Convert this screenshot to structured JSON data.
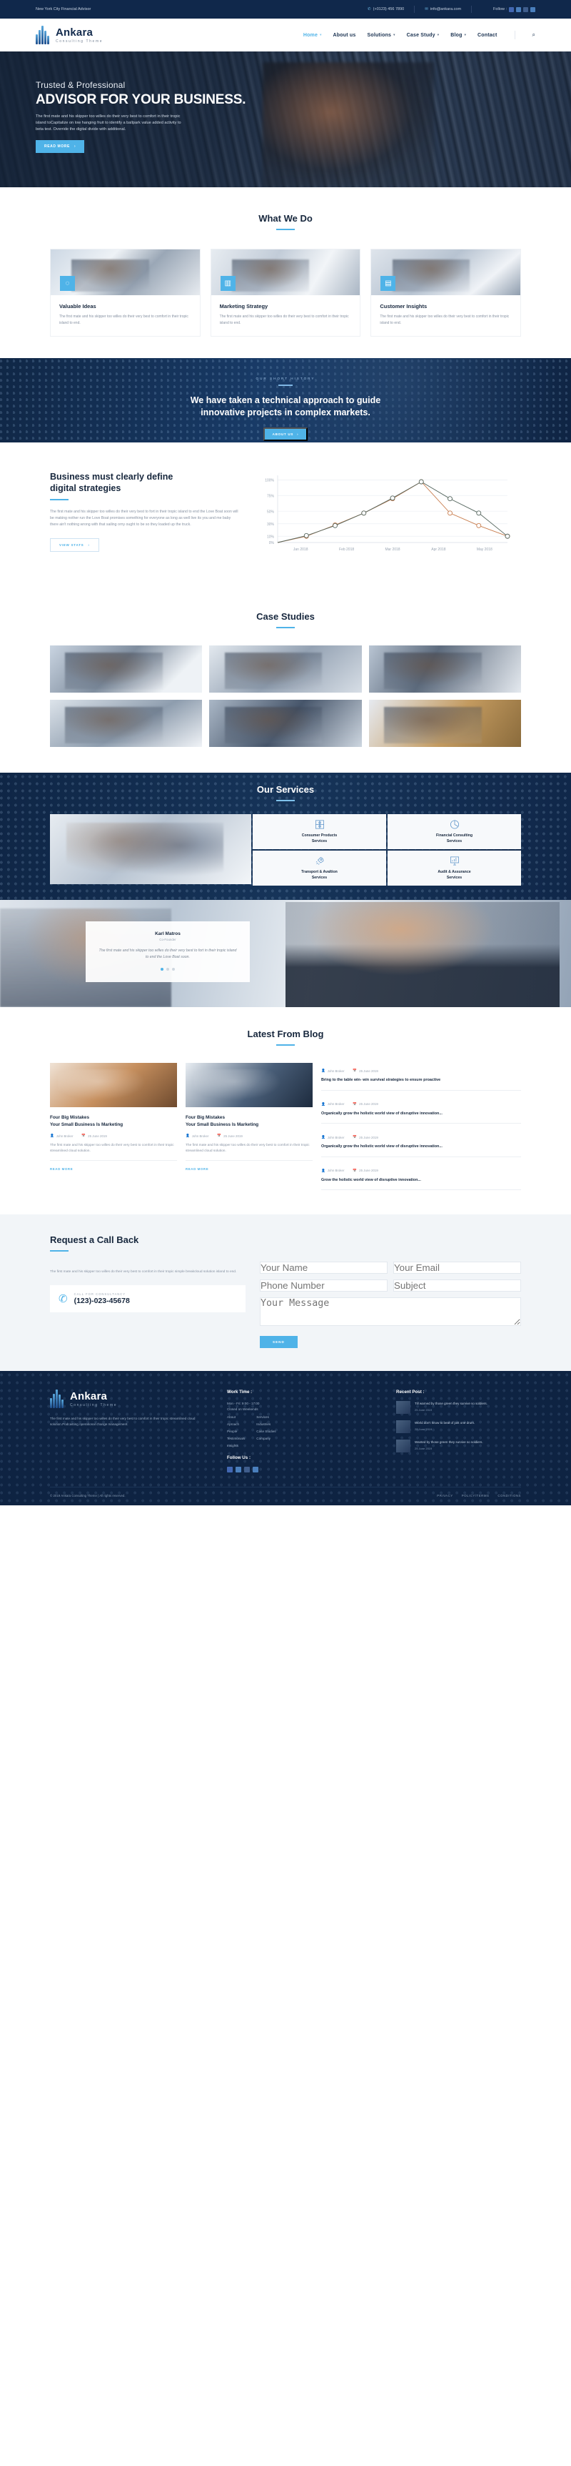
{
  "topbar": {
    "tagline": "New York City Financial Advisor",
    "phone": "(+0123) 456 7890",
    "email": "info@ankara.com",
    "follow_label": "Follow :",
    "social": [
      "facebook-icon",
      "twitter-icon",
      "instagram-icon",
      "linkedin-icon"
    ]
  },
  "brand": {
    "name": "Ankara",
    "sub": "Consulting Theme"
  },
  "nav": {
    "items": [
      {
        "label": "Home",
        "caret": "▾",
        "active": true
      },
      {
        "label": "About us",
        "caret": "",
        "active": false
      },
      {
        "label": "Solutions",
        "caret": "▾",
        "active": false
      },
      {
        "label": "Case Study",
        "caret": "▾",
        "active": false
      },
      {
        "label": "Blog",
        "caret": "▾",
        "active": false
      },
      {
        "label": "Contact",
        "caret": "",
        "active": false
      }
    ],
    "search_icon": "search-icon"
  },
  "hero": {
    "kicker": "Trusted & Professional",
    "title": "ADVISOR FOR YOUR BUSINESS.",
    "body": "The first mate and his skipper too willes do their very best to comfort in their tropic island toCapitalize on low hanging fruit to identify a ballpark value added activity to beta test. Override the digital divide with additional.",
    "cta": "Read More"
  },
  "whatwedo": {
    "title": "What We Do",
    "cards": [
      {
        "icon": "lightbulb-icon",
        "title": "Valuable Ideas",
        "body": "The first mate and his skipper too willes do their very best to comfort in their tropic island to end."
      },
      {
        "icon": "bar-chart-icon",
        "title": "Marketing Strategy",
        "body": "The first mate and his skipper too willes do their very best to comfort in their tropic island to end."
      },
      {
        "icon": "monitor-icon",
        "title": "Customer Insights",
        "body": "The first mate and his skipper too willes do their very best to comfort in their tropic island to end."
      }
    ]
  },
  "cta_band": {
    "kicker": "OUR SHORT HISTORY",
    "title_line1": "We have taken a technical approach to guide",
    "title_line2": "innovative projects in complex markets.",
    "button": "About Us"
  },
  "stats": {
    "title_line1": "Business must clearly define",
    "title_line2": "digital strategies",
    "body": "The first mate and his skipper too willes do their very best to fort in their tropic island to end the Love Boat soon will be making nother run the Love Boat promises something for everyone as long as well live its you and me baby there ain't nothing wrong with that sailing orny ought to be so they loaded up the truck.",
    "button": "View Stats"
  },
  "chart_data": {
    "type": "line",
    "title": "",
    "xlabel": "",
    "ylabel": "",
    "x": [
      "Jan 2018",
      "Feb 2018",
      "Mar 2018",
      "Apr 2018",
      "May 2018"
    ],
    "ytick_labels": [
      "0%",
      "10%",
      "30%",
      "50%",
      "75%",
      "100%"
    ],
    "ytick_values": [
      0,
      10,
      30,
      50,
      75,
      100
    ],
    "ylim": [
      0,
      105
    ],
    "grid": true,
    "legend": "none",
    "series": [
      {
        "name": "Series A",
        "color": "#c87d4e",
        "x": [
          0,
          0.5,
          1,
          1.5,
          2,
          2.5,
          3,
          3.5,
          4
        ],
        "values": [
          0,
          10,
          28,
          47,
          70,
          97,
          47,
          27,
          10
        ]
      },
      {
        "name": "Series B",
        "color": "#55665e",
        "x": [
          0,
          0.5,
          1,
          1.5,
          2,
          2.5,
          3,
          3.5,
          4
        ],
        "values": [
          0,
          11,
          27,
          47,
          71,
          97,
          70,
          47,
          10
        ]
      }
    ]
  },
  "cases": {
    "title": "Case Studies",
    "tiles": [
      "case-tile-1",
      "case-tile-2",
      "case-tile-3",
      "case-tile-4",
      "case-tile-5",
      "case-tile-6"
    ]
  },
  "services": {
    "title": "Our Services",
    "items": [
      {
        "icon": "puzzle-icon",
        "line1": "Consumer Products",
        "line2": "Services"
      },
      {
        "icon": "pie-chart-icon",
        "line1": "Financial Consulting",
        "line2": "Services"
      },
      {
        "icon": "rocket-icon",
        "line1": "Transport & Avaltion",
        "line2": "Services"
      },
      {
        "icon": "presentation-chart-icon",
        "line1": "Audit & Assurance",
        "line2": "Services"
      }
    ]
  },
  "testimonial": {
    "name": "Karl Matros",
    "role": "Co-Founder",
    "quote": "The first mate and his skipper too willes do their very best to fort in their tropic island to end the Love Boat soon.",
    "dots": 3,
    "active_dot": 0
  },
  "blog": {
    "title": "Latest From Blog",
    "posts": [
      {
        "title_line1": "Four Big Mistakes",
        "title_line2": "Your Small Business Is Marketing",
        "author": "John Broker",
        "date": "25 June 2019",
        "excerpt": "The first mate and his skipper too willes do their very best to comfort in their tropic streamlined cloud solution.",
        "readmore": "Read More"
      },
      {
        "title_line1": "Four Big Mistakes",
        "title_line2": "Your Small Business Is Marketing",
        "author": "John Broker",
        "date": "25 June 2019",
        "excerpt": "The first mate and his skipper too willes do their very best to comfort in their tropic streamlined cloud solution.",
        "readmore": "Read More"
      }
    ],
    "list": [
      {
        "author": "John Broker",
        "date": "25 June 2019",
        "title": "Bring to the table win- win survival strategies to ensure proactive"
      },
      {
        "author": "John Broker",
        "date": "25 June 2019",
        "title": "Organically grow the holistic world view of disruptive innovation..."
      },
      {
        "author": "John Broker",
        "date": "25 June 2019",
        "title": "Organically grow the holistic world view of disruptive innovation..."
      },
      {
        "author": "John Broker",
        "date": "25 June 2019",
        "title": "Grow the holistic world view of disruptive innovation..."
      }
    ]
  },
  "callback": {
    "title": "Request a Call Back",
    "body": "The first mate and his skipper too willes do their very best to comfort in their tropic simple breakcloud solution island to end.",
    "phone_label": "Call For Consultancy",
    "phone": "(123)-023-45678",
    "fields": {
      "name": "Your Name",
      "email": "Your Email",
      "phone": "Phone Number",
      "subject": "Subject",
      "message": "Your Message"
    },
    "submit": "Send"
  },
  "footer": {
    "brand": {
      "name": "Ankara",
      "sub": "Consulting Theme"
    },
    "about": "The first mate and his skipper too willes do their very best to comfort in their tropic streamlined cloud solution.Podcasting operational change management.",
    "work_time": {
      "heading": "Work Time :",
      "line1": "Mon - Fri: 9:00 - 17:00",
      "line2": "Closed on Weekends"
    },
    "links_heading": "",
    "links_col1": [
      "About",
      "Aproach",
      "People",
      "Testimonials",
      "Insights"
    ],
    "links_col2": [
      "Services",
      "Industries",
      "Case Studies",
      "Company"
    ],
    "follow_heading": "Follow Us :",
    "social": [
      "facebook-icon",
      "twitter-icon",
      "instagram-icon",
      "linkedin-icon"
    ],
    "recent_heading": "Recent Post :",
    "recent": [
      {
        "text": "Till warned by those green they survive so soldiers.",
        "date": "25 June 2019"
      },
      {
        "text": "World don't know to beat of just one drum.",
        "date": "25 June 2019"
      },
      {
        "text": "Wanted by those green they survive so soldiers.",
        "date": "25 June 2019"
      }
    ],
    "copyright": "© 2019 Ankara Consulting Theme | All rights reserved.",
    "bottom_links": [
      "PRIVACY",
      "POLICY/TERMS",
      "CONDITIONS"
    ]
  }
}
